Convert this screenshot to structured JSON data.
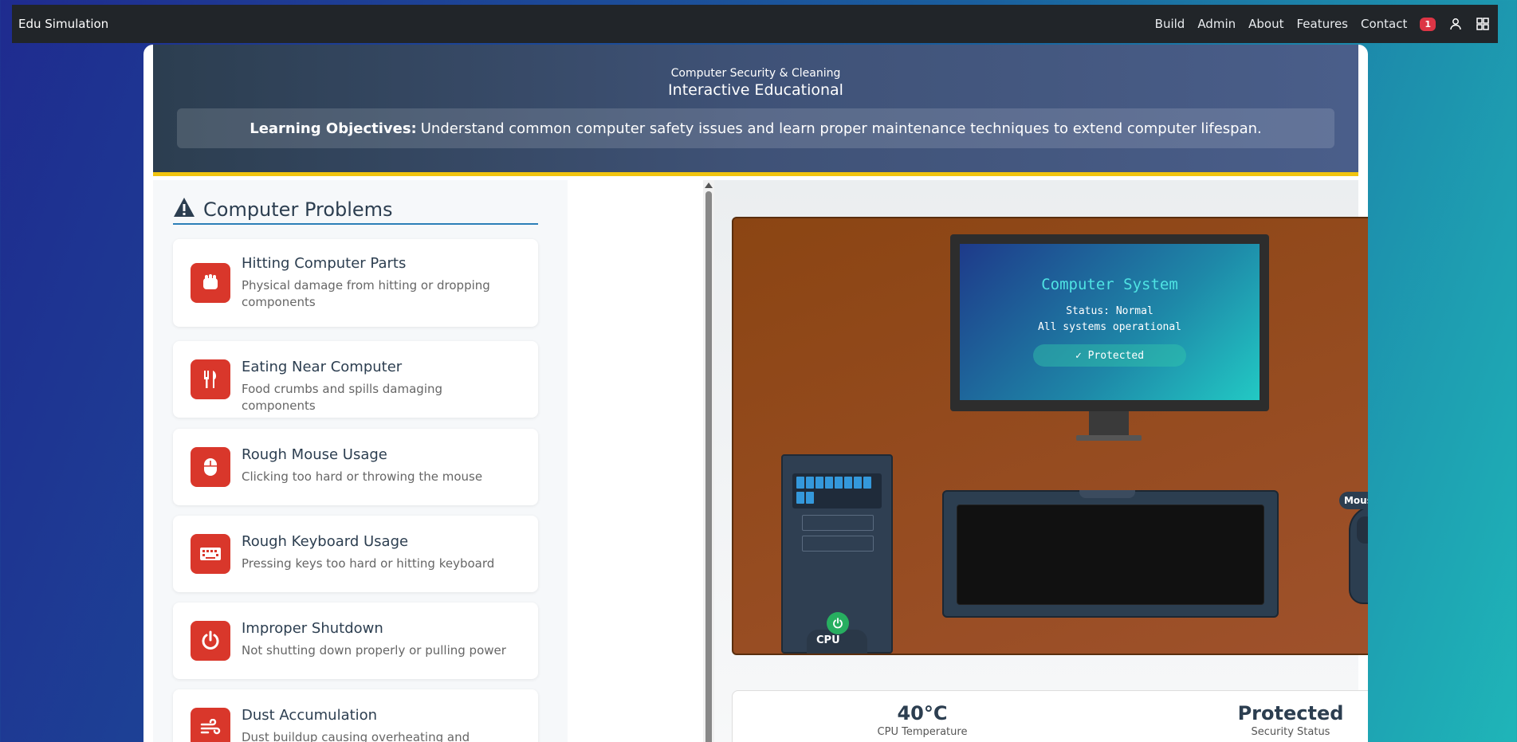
{
  "navbar": {
    "brand": "Edu Simulation",
    "links": [
      "Build",
      "Admin",
      "About",
      "Features",
      "Contact"
    ],
    "notification_count": "1",
    "icons": [
      "user-icon",
      "apps-grid-icon"
    ]
  },
  "hero": {
    "subtitle": "Computer Security & Cleaning",
    "title": "Interactive Educational",
    "objectives_label": "Learning Objectives:",
    "objectives_text": "Understand common computer safety issues and learn proper maintenance techniques to extend computer lifespan."
  },
  "problems_panel": {
    "title": "Computer Problems",
    "items": [
      {
        "title": "Hitting Computer Parts",
        "desc": "Physical damage from hitting or dropping components",
        "icon": "fist-icon"
      },
      {
        "title": "Eating Near Computer",
        "desc": "Food crumbs and spills damaging components",
        "icon": "utensils-icon"
      },
      {
        "title": "Rough Mouse Usage",
        "desc": "Clicking too hard or throwing the mouse",
        "icon": "mouse-icon"
      },
      {
        "title": "Rough Keyboard Usage",
        "desc": "Pressing keys too hard or hitting keyboard",
        "icon": "keyboard-icon"
      },
      {
        "title": "Improper Shutdown",
        "desc": "Not shutting down properly or pulling power",
        "icon": "power-icon"
      },
      {
        "title": "Dust Accumulation",
        "desc": "Dust buildup causing overheating and damage",
        "icon": "wind-icon"
      }
    ]
  },
  "simulation": {
    "screen_title": "Computer System",
    "screen_status": "Status: Normal",
    "screen_message": "All systems operational",
    "screen_badge": "✓ Protected",
    "tower_label": "CPU",
    "mouse_label": "Mouse"
  },
  "stats": {
    "cpu_temp_value": "40°C",
    "cpu_temp_label": "CPU Temperature",
    "security_value": "Protected",
    "security_label": "Security Status"
  },
  "colors": {
    "problem_icon_bg": "#d9372b",
    "accent_border": "#f1c40f",
    "desk": "#a0522d"
  }
}
